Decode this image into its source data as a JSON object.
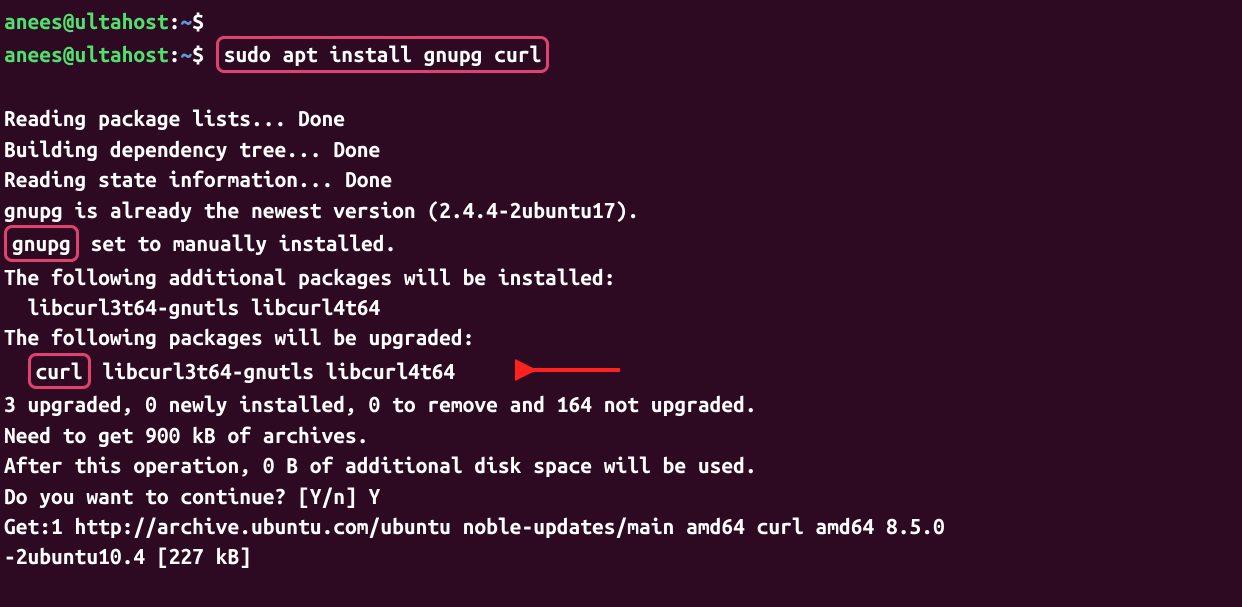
{
  "prompt1": {
    "user": "anees@ultahost",
    "sep": ":",
    "path": "~",
    "dollar": "$"
  },
  "prompt2": {
    "user": "anees@ultahost",
    "sep": ":",
    "path": "~",
    "dollar": "$",
    "command": "sudo apt install gnupg curl"
  },
  "lines": {
    "l1": "Reading package lists... Done",
    "l2": "Building dependency tree... Done",
    "l3": "Reading state information... Done",
    "l4": "gnupg is already the newest version (2.4.4-2ubuntu17).",
    "l5a": "gnupg",
    "l5b": " set to manually installed.",
    "l6": "The following additional packages will be installed:",
    "l7": "  libcurl3t64-gnutls libcurl4t64",
    "l8": "The following packages will be upgraded:",
    "l9a": "curl",
    "l9b": " libcurl3t64-gnutls libcurl4t64",
    "l10": "3 upgraded, 0 newly installed, 0 to remove and 164 not upgraded.",
    "l11": "Need to get 900 kB of archives.",
    "l12": "After this operation, 0 B of additional disk space will be used.",
    "l13": "Do you want to continue? [Y/n] Y",
    "l14": "Get:1 http://archive.ubuntu.com/ubuntu noble-updates/main amd64 curl amd64 8.5.0",
    "l15": "-2ubuntu10.4 [227 kB]"
  }
}
